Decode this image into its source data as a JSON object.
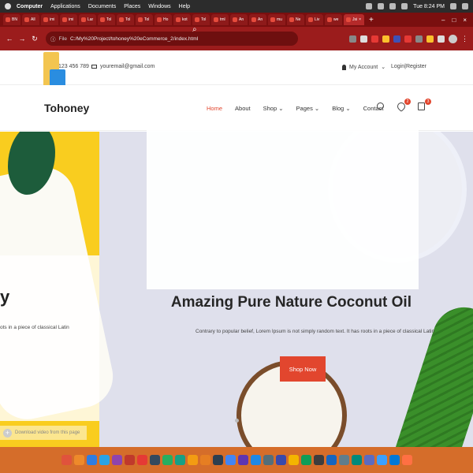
{
  "os": {
    "menubar": [
      "Computer",
      "Applications",
      "Documents",
      "Places",
      "Windows",
      "Help"
    ],
    "clock": "Tue 8:24 PM"
  },
  "browser": {
    "tabs": [
      "BN",
      "All",
      "imi",
      "imi",
      "Lar",
      "Tol",
      "Tol",
      "Tol",
      "Ho",
      "kot",
      "Tol",
      "tml",
      "An",
      "An",
      "mu",
      "Ne",
      "Liv",
      "we",
      "Jsi"
    ],
    "url": "C:/My%20Project/tohoney%20eCommerce_2/index.html",
    "file_label": "File"
  },
  "site": {
    "phone": "123 456 789",
    "email": "youremail@gmail.com",
    "account": "My Account",
    "login": "Login|Register",
    "logo": "Tohoney",
    "nav": [
      "Home",
      "About",
      "Shop",
      "Pages",
      "Blog",
      "Contact"
    ],
    "wishlist_count": "2",
    "cart_count": "3"
  },
  "hero": {
    "title": "Amazing Pure Nature Coconut Oil",
    "text": "Contrary to popular belief, Lorem Ipsum is not simply random text. It has roots in a piece of classical Latin",
    "button": "Shop Now",
    "left_title_fragment": "y",
    "left_text_fragment": "ots in a piece of classical Latin"
  },
  "download_bar": {
    "text": "Download video from this page"
  },
  "dock_colors": [
    "#e0533c",
    "#ee8a2a",
    "#2f7de1",
    "#2aa3e6",
    "#8e44ad",
    "#c0392b",
    "#e53935",
    "#34495e",
    "#27ae60",
    "#16a085",
    "#f39c12",
    "#e67e22",
    "#2c3e50",
    "#4285f4",
    "#5e35b1",
    "#1e88e5",
    "#546e7a",
    "#3949ab",
    "#f4b400",
    "#0f9d58",
    "#3d3d3d",
    "#1565c0",
    "#607d8b",
    "#00897b",
    "#5c6bc0",
    "#3ba0ff",
    "#0078d7",
    "#ff7043"
  ]
}
